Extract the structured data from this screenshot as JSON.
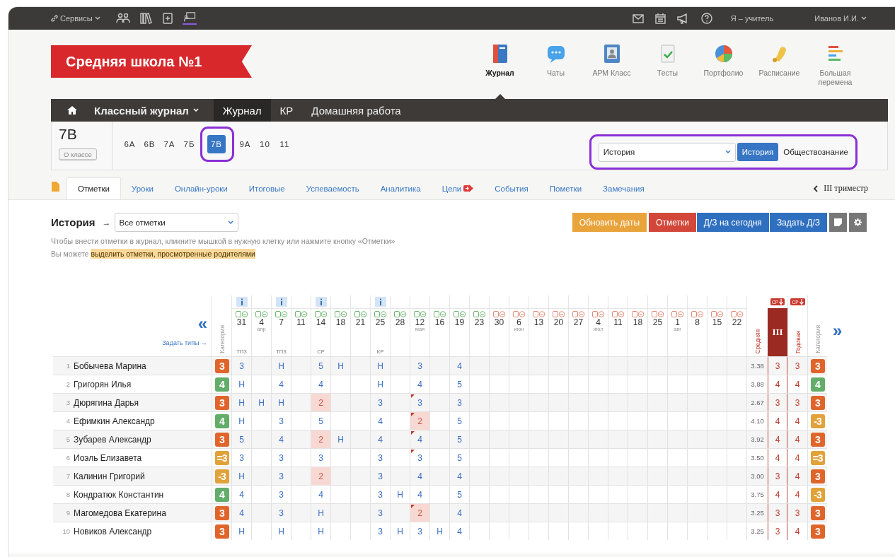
{
  "top_bar": {
    "services": "Сервисы",
    "role": "Я – учитель",
    "user": "Иванов И.И."
  },
  "school": {
    "name": "Средняя школа №1"
  },
  "apps": [
    {
      "label": "Журнал",
      "kind": "journal",
      "selected": true
    },
    {
      "label": "Чаты",
      "kind": "chats",
      "selected": false
    },
    {
      "label": "АРМ Класс",
      "kind": "class",
      "selected": false
    },
    {
      "label": "Тесты",
      "kind": "tests",
      "selected": false
    },
    {
      "label": "Портфолио",
      "kind": "portfolio",
      "selected": false
    },
    {
      "label": "Расписание",
      "kind": "schedule",
      "selected": false
    },
    {
      "label": "Большая перемена",
      "kind": "break",
      "selected": false
    }
  ],
  "nav": [
    {
      "label": "Классный журнал",
      "kind": "menu",
      "selected": false
    },
    {
      "label": "Журнал",
      "kind": "link",
      "selected": true
    },
    {
      "label": "КР",
      "kind": "link",
      "selected": false
    },
    {
      "label": "Домашняя работа",
      "kind": "link",
      "selected": false
    }
  ],
  "class_panel": {
    "current": "7В",
    "about_button": "О классе",
    "classes": [
      {
        "label": "6А",
        "selected": false,
        "highlighted": false
      },
      {
        "label": "6В",
        "selected": false,
        "highlighted": false
      },
      {
        "label": "7А",
        "selected": false,
        "highlighted": false
      },
      {
        "label": "7Б",
        "selected": false,
        "highlighted": false
      },
      {
        "label": "7В",
        "selected": true,
        "highlighted": true
      },
      {
        "label": "9А",
        "selected": false,
        "highlighted": false
      },
      {
        "label": "10",
        "selected": false,
        "highlighted": false
      },
      {
        "label": "11",
        "selected": false,
        "highlighted": false
      }
    ],
    "subject_select": "История",
    "subjects_highlighted": true,
    "subjects": [
      {
        "label": "История",
        "selected": true
      },
      {
        "label": "Обществознание",
        "selected": false
      }
    ]
  },
  "tabs": [
    {
      "label": "Отметки",
      "selected": true,
      "badge": false
    },
    {
      "label": "Уроки",
      "selected": false,
      "badge": false
    },
    {
      "label": "Онлайн-уроки",
      "selected": false,
      "badge": false
    },
    {
      "label": "Итоговые",
      "selected": false,
      "badge": false
    },
    {
      "label": "Успеваемость",
      "selected": false,
      "badge": false
    },
    {
      "label": "Аналитика",
      "selected": false,
      "badge": false
    },
    {
      "label": "Цели",
      "selected": false,
      "badge": true
    },
    {
      "label": "События",
      "selected": false,
      "badge": false
    },
    {
      "label": "Пометки",
      "selected": false,
      "badge": false
    },
    {
      "label": "Замечания",
      "selected": false,
      "badge": false
    }
  ],
  "term": "III триместр",
  "toolbar": {
    "subject": "История",
    "arrow": "→",
    "filter": "Все отметки",
    "buttons": [
      {
        "label": "Обновить даты",
        "kind": "warning"
      },
      {
        "label": "Отметки",
        "kind": "danger"
      },
      {
        "label": "Д/З на сегодня",
        "kind": "primary"
      },
      {
        "label": "Задать Д/З",
        "kind": "primary"
      }
    ]
  },
  "hint": "Чтобы внести отметки в журнал, кликните мышкой в нужную клетку или нажмите кнопку «Отметки»",
  "note": {
    "prefix": "Вы можете",
    "link": "выделить отметки, просмотренные родителями"
  },
  "grid": {
    "prev": "«",
    "next": "»",
    "set_types": "Задать типы →",
    "category_header": "Категория",
    "average_header": "Средняя",
    "term_header": "III",
    "term_badge": "СР",
    "year_header": "Годовая",
    "year_badge": "СР",
    "final_category_header": "Категория",
    "columns": [
      {
        "day": "31",
        "type": "ТПЗ",
        "info": true,
        "past": true
      },
      {
        "day": "4",
        "month": "апр",
        "info": false,
        "past": true
      },
      {
        "day": "7",
        "type": "ТПЗ",
        "info": true,
        "past": true
      },
      {
        "day": "11",
        "info": false,
        "past": true
      },
      {
        "day": "14",
        "type": "СР",
        "info": true,
        "past": true
      },
      {
        "day": "18",
        "info": false,
        "past": true
      },
      {
        "day": "21",
        "info": false,
        "past": true
      },
      {
        "day": "25",
        "type": "КР",
        "info": true,
        "past": true
      },
      {
        "day": "28",
        "info": false,
        "past": true
      },
      {
        "day": "12",
        "month": "мая",
        "info": false,
        "past": true
      },
      {
        "day": "16",
        "info": false,
        "past": true
      },
      {
        "day": "19",
        "info": false,
        "past": true
      },
      {
        "day": "23",
        "info": false,
        "past": true
      },
      {
        "day": "30",
        "info": false,
        "past": false
      },
      {
        "day": "6",
        "month": "июн",
        "info": false,
        "past": false
      },
      {
        "day": "13",
        "info": false,
        "past": false
      },
      {
        "day": "20",
        "info": false,
        "past": false
      },
      {
        "day": "27",
        "info": false,
        "past": false
      },
      {
        "day": "4",
        "month": "июл",
        "info": false,
        "past": false
      },
      {
        "day": "11",
        "info": false,
        "past": false
      },
      {
        "day": "18",
        "info": false,
        "past": false
      },
      {
        "day": "25",
        "info": false,
        "past": false
      },
      {
        "day": "1",
        "month": "авг",
        "info": false,
        "past": false
      },
      {
        "day": "8",
        "info": false,
        "past": false
      },
      {
        "day": "15",
        "info": false,
        "past": false
      },
      {
        "day": "22",
        "info": false,
        "past": false
      }
    ],
    "rows": [
      {
        "num": "1",
        "name": "Бобычева Марина",
        "category": {
          "text": "3",
          "color": "#e0652b"
        },
        "marks": [
          {
            "kind": "grade",
            "text": "3",
            "low": false,
            "note": false
          },
          {
            "kind": "empty"
          },
          {
            "kind": "grade",
            "text": "Н",
            "low": false,
            "note": false
          },
          {
            "kind": "empty"
          },
          {
            "kind": "grade",
            "text": "5",
            "low": false,
            "note": false
          },
          {
            "kind": "grade",
            "text": "Н",
            "low": false,
            "note": false
          },
          {
            "kind": "empty"
          },
          {
            "kind": "grade",
            "text": "Н",
            "low": false,
            "note": false
          },
          {
            "kind": "empty"
          },
          {
            "kind": "grade",
            "text": "3",
            "low": false,
            "note": false
          },
          {
            "kind": "empty"
          },
          {
            "kind": "grade",
            "text": "4",
            "low": false,
            "note": false
          }
        ],
        "average": "3.38",
        "term": "3",
        "year": "3",
        "final_category": {
          "text": "3",
          "color": "#e0652b"
        }
      },
      {
        "num": "2",
        "name": "Григорян Илья",
        "category": {
          "text": "4",
          "color": "#63ad6b"
        },
        "marks": [
          {
            "kind": "grade",
            "text": "Н",
            "low": false,
            "note": false
          },
          {
            "kind": "empty"
          },
          {
            "kind": "grade",
            "text": "4",
            "low": false,
            "note": false
          },
          {
            "kind": "empty"
          },
          {
            "kind": "grade",
            "text": "4",
            "low": false,
            "note": false
          },
          {
            "kind": "empty"
          },
          {
            "kind": "empty"
          },
          {
            "kind": "grade",
            "text": "Н",
            "low": false,
            "note": false
          },
          {
            "kind": "empty"
          },
          {
            "kind": "grade",
            "text": "4",
            "low": false,
            "note": false
          },
          {
            "kind": "empty"
          },
          {
            "kind": "grade",
            "text": "5",
            "low": false,
            "note": false
          }
        ],
        "average": "3.88",
        "term": "4",
        "year": "4",
        "final_category": {
          "text": "4",
          "color": "#63ad6b"
        }
      },
      {
        "num": "3",
        "name": "Дюрягина Дарья",
        "category": {
          "text": "3",
          "color": "#e0652b"
        },
        "marks": [
          {
            "kind": "grade",
            "text": "Н",
            "low": false,
            "note": false
          },
          {
            "kind": "grade",
            "text": "Н",
            "low": false,
            "note": false
          },
          {
            "kind": "grade",
            "text": "Н",
            "low": false,
            "note": false
          },
          {
            "kind": "empty"
          },
          {
            "kind": "grade",
            "text": "2",
            "low": true,
            "note": false
          },
          {
            "kind": "empty"
          },
          {
            "kind": "empty"
          },
          {
            "kind": "grade",
            "text": "3",
            "low": false,
            "note": false
          },
          {
            "kind": "empty"
          },
          {
            "kind": "grade",
            "text": "3",
            "low": false,
            "note": true
          },
          {
            "kind": "empty"
          },
          {
            "kind": "grade",
            "text": "3",
            "low": false,
            "note": false
          }
        ],
        "average": "2.67",
        "term": "3",
        "year": "3",
        "final_category": {
          "text": "3",
          "color": "#e0652b"
        }
      },
      {
        "num": "4",
        "name": "Ефимкин Александр",
        "category": {
          "text": "4",
          "color": "#63ad6b"
        },
        "marks": [
          {
            "kind": "grade",
            "text": "Н",
            "low": false,
            "note": false
          },
          {
            "kind": "empty"
          },
          {
            "kind": "grade",
            "text": "3",
            "low": false,
            "note": false
          },
          {
            "kind": "empty"
          },
          {
            "kind": "grade",
            "text": "5",
            "low": false,
            "note": false
          },
          {
            "kind": "empty"
          },
          {
            "kind": "empty"
          },
          {
            "kind": "grade",
            "text": "4",
            "low": false,
            "note": false
          },
          {
            "kind": "empty"
          },
          {
            "kind": "grade",
            "text": "2",
            "low": true,
            "note": true
          },
          {
            "kind": "empty"
          },
          {
            "kind": "grade",
            "text": "5",
            "low": false,
            "note": false
          }
        ],
        "average": "4.10",
        "term": "4",
        "year": "4",
        "final_category": {
          "text": "-3",
          "color": "#e1a23a"
        }
      },
      {
        "num": "5",
        "name": "Зубарев Александр",
        "category": {
          "text": "3",
          "color": "#e0652b"
        },
        "marks": [
          {
            "kind": "grade",
            "text": "5",
            "low": false,
            "note": false
          },
          {
            "kind": "empty"
          },
          {
            "kind": "grade",
            "text": "4",
            "low": false,
            "note": false
          },
          {
            "kind": "empty"
          },
          {
            "kind": "grade",
            "text": "2",
            "low": true,
            "note": false
          },
          {
            "kind": "grade",
            "text": "Н",
            "low": false,
            "note": false
          },
          {
            "kind": "empty"
          },
          {
            "kind": "grade",
            "text": "4",
            "low": false,
            "note": false
          },
          {
            "kind": "empty"
          },
          {
            "kind": "grade",
            "text": "4",
            "low": false,
            "note": true
          },
          {
            "kind": "empty"
          },
          {
            "kind": "grade",
            "text": "5",
            "low": false,
            "note": false
          }
        ],
        "average": "3.92",
        "term": "4",
        "year": "4",
        "final_category": {
          "text": "3",
          "color": "#e0652b"
        }
      },
      {
        "num": "6",
        "name": "Иоэль Елизавета",
        "category": {
          "text": "=3",
          "color": "#e1a23a"
        },
        "marks": [
          {
            "kind": "grade",
            "text": "3",
            "low": false,
            "note": false
          },
          {
            "kind": "empty"
          },
          {
            "kind": "grade",
            "text": "3",
            "low": false,
            "note": false
          },
          {
            "kind": "empty"
          },
          {
            "kind": "grade",
            "text": "3",
            "low": false,
            "note": false
          },
          {
            "kind": "empty"
          },
          {
            "kind": "empty"
          },
          {
            "kind": "grade",
            "text": "3",
            "low": false,
            "note": false
          },
          {
            "kind": "empty"
          },
          {
            "kind": "grade",
            "text": "3",
            "low": false,
            "note": true
          },
          {
            "kind": "empty"
          },
          {
            "kind": "grade",
            "text": "5",
            "low": false,
            "note": false
          }
        ],
        "average": "3.50",
        "term": "4",
        "year": "4",
        "final_category": {
          "text": "=3",
          "color": "#e1a23a"
        }
      },
      {
        "num": "7",
        "name": "Калинин Григорий",
        "category": {
          "text": "-3",
          "color": "#e1a23a"
        },
        "marks": [
          {
            "kind": "grade",
            "text": "Н",
            "low": false,
            "note": false
          },
          {
            "kind": "empty"
          },
          {
            "kind": "grade",
            "text": "3",
            "low": false,
            "note": false
          },
          {
            "kind": "empty"
          },
          {
            "kind": "grade",
            "text": "2",
            "low": true,
            "note": false
          },
          {
            "kind": "empty"
          },
          {
            "kind": "empty"
          },
          {
            "kind": "grade",
            "text": "3",
            "low": false,
            "note": false
          },
          {
            "kind": "empty"
          },
          {
            "kind": "grade",
            "text": "4",
            "low": false,
            "note": false
          },
          {
            "kind": "empty"
          },
          {
            "kind": "grade",
            "text": "4",
            "low": false,
            "note": false
          }
        ],
        "average": "3.00",
        "term": "3",
        "year": "4",
        "final_category": {
          "text": "3",
          "color": "#e0652b"
        }
      },
      {
        "num": "8",
        "name": "Кондратюк Константин",
        "category": {
          "text": "4",
          "color": "#63ad6b"
        },
        "marks": [
          {
            "kind": "grade",
            "text": "4",
            "low": false,
            "note": false
          },
          {
            "kind": "empty"
          },
          {
            "kind": "grade",
            "text": "3",
            "low": false,
            "note": false
          },
          {
            "kind": "empty"
          },
          {
            "kind": "grade",
            "text": "4",
            "low": false,
            "note": false
          },
          {
            "kind": "empty"
          },
          {
            "kind": "empty"
          },
          {
            "kind": "grade",
            "text": "3",
            "low": false,
            "note": false
          },
          {
            "kind": "grade",
            "text": "Н",
            "low": false,
            "note": false
          },
          {
            "kind": "grade",
            "text": "4",
            "low": false,
            "note": false
          },
          {
            "kind": "empty"
          },
          {
            "kind": "grade",
            "text": "5",
            "low": false,
            "note": false
          }
        ],
        "average": "3.75",
        "term": "4",
        "year": "4",
        "final_category": {
          "text": "-3",
          "color": "#e1a23a"
        }
      },
      {
        "num": "9",
        "name": "Магомедова Екатерина",
        "category": {
          "text": "3",
          "color": "#e0652b"
        },
        "marks": [
          {
            "kind": "grade",
            "text": "4",
            "low": false,
            "note": false
          },
          {
            "kind": "empty"
          },
          {
            "kind": "grade",
            "text": "3",
            "low": false,
            "note": false
          },
          {
            "kind": "empty"
          },
          {
            "kind": "grade",
            "text": "Н",
            "low": false,
            "note": false
          },
          {
            "kind": "empty"
          },
          {
            "kind": "empty"
          },
          {
            "kind": "grade",
            "text": "3",
            "low": false,
            "note": false
          },
          {
            "kind": "empty"
          },
          {
            "kind": "grade",
            "text": "2",
            "low": true,
            "note": true
          },
          {
            "kind": "empty"
          },
          {
            "kind": "grade",
            "text": "4",
            "low": false,
            "note": false
          }
        ],
        "average": "3.25",
        "term": "3",
        "year": "3",
        "final_category": {
          "text": "3",
          "color": "#e0652b"
        }
      },
      {
        "num": "10",
        "name": "Новиков Александр",
        "category": {
          "text": "3",
          "color": "#e0652b"
        },
        "marks": [
          {
            "kind": "grade",
            "text": "Н",
            "low": false,
            "note": false
          },
          {
            "kind": "empty"
          },
          {
            "kind": "grade",
            "text": "Н",
            "low": false,
            "note": false
          },
          {
            "kind": "empty"
          },
          {
            "kind": "grade",
            "text": "Н",
            "low": false,
            "note": false
          },
          {
            "kind": "empty"
          },
          {
            "kind": "empty"
          },
          {
            "kind": "grade",
            "text": "3",
            "low": false,
            "note": false
          },
          {
            "kind": "grade",
            "text": "Н",
            "low": false,
            "note": false
          },
          {
            "kind": "grade",
            "text": "3",
            "low": false,
            "note": false
          },
          {
            "kind": "grade",
            "text": "Н",
            "low": false,
            "note": false
          },
          {
            "kind": "grade",
            "text": "4",
            "low": false,
            "note": false
          }
        ],
        "average": "3.25",
        "term": "3",
        "year": "4",
        "final_category": {
          "text": "3",
          "color": "#e0652b"
        }
      }
    ]
  }
}
